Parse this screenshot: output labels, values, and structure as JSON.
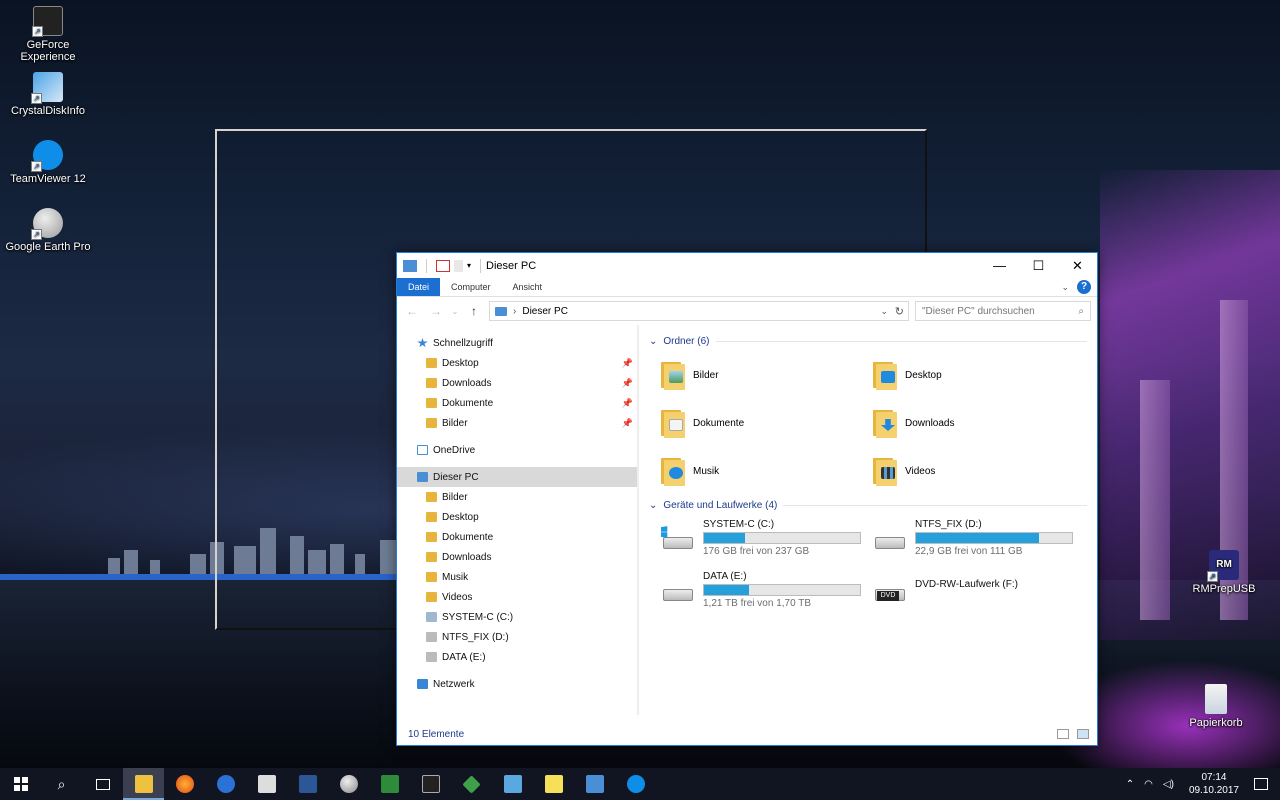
{
  "desktop": {
    "icons": [
      {
        "label": "GeForce Experience"
      },
      {
        "label": "CrystalDiskInfo"
      },
      {
        "label": "TeamViewer 12"
      },
      {
        "label": "Google Earth Pro"
      },
      {
        "label": "RMPrepUSB"
      },
      {
        "label": "Papierkorb"
      }
    ]
  },
  "window": {
    "title": "Dieser PC",
    "controls": {
      "minimize": "—",
      "maximize": "☐",
      "close": "✕"
    },
    "ribbon": {
      "tabs": [
        "Datei",
        "Computer",
        "Ansicht"
      ],
      "help": "?"
    },
    "address": {
      "path": "Dieser PC",
      "search_placeholder": "\"Dieser PC\" durchsuchen"
    },
    "nav": {
      "quick_access": "Schnellzugriff",
      "quick_items": [
        "Desktop",
        "Downloads",
        "Dokumente",
        "Bilder"
      ],
      "onedrive": "OneDrive",
      "this_pc": "Dieser PC",
      "pc_items": [
        "Bilder",
        "Desktop",
        "Dokumente",
        "Downloads",
        "Musik",
        "Videos",
        "SYSTEM-C (C:)",
        "NTFS_FIX (D:)",
        "DATA (E:)"
      ],
      "network": "Netzwerk"
    },
    "content": {
      "folders_header": "Ordner (6)",
      "folders": [
        "Bilder",
        "Desktop",
        "Dokumente",
        "Downloads",
        "Musik",
        "Videos"
      ],
      "drives_header": "Geräte und Laufwerke (4)",
      "drives": [
        {
          "name": "SYSTEM-C (C:)",
          "free": "176 GB frei von 237 GB",
          "used_fraction": 0.26
        },
        {
          "name": "NTFS_FIX (D:)",
          "free": "22,9 GB frei von 111 GB",
          "used_fraction": 0.79
        },
        {
          "name": "DATA (E:)",
          "free": "1,21 TB frei von 1,70 TB",
          "used_fraction": 0.29
        },
        {
          "name": "DVD-RW-Laufwerk (F:)"
        }
      ]
    },
    "status": "10 Elemente"
  },
  "taskbar": {
    "time": "07:14",
    "date": "09.10.2017"
  },
  "colors": {
    "accent": "#1a6fd1",
    "drive_bar": "#26a0da",
    "taskbar": "#101521"
  }
}
